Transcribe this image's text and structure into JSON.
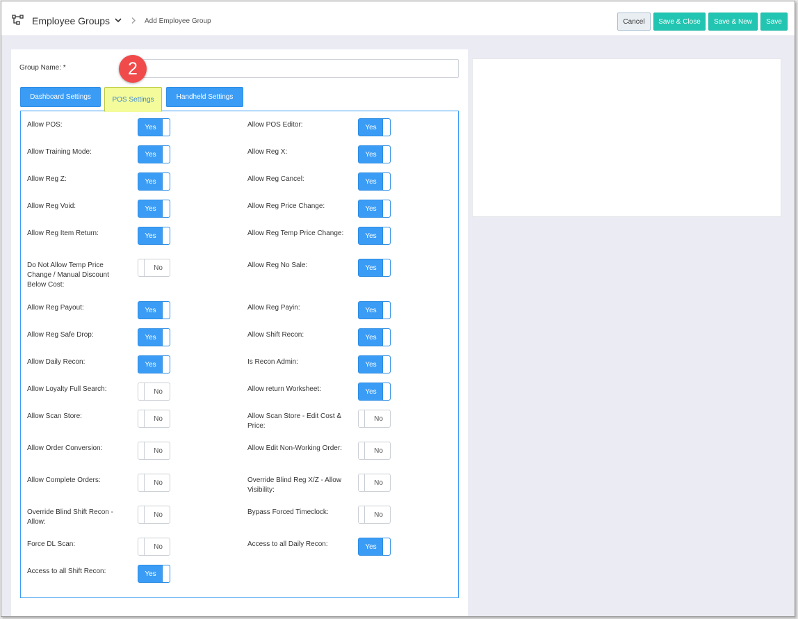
{
  "header": {
    "module_title": "Employee Groups",
    "breadcrumb": "Add Employee Group",
    "buttons": {
      "cancel": "Cancel",
      "save_close": "Save & Close",
      "save_new": "Save & New",
      "save": "Save"
    }
  },
  "form": {
    "group_name_label": "Group Name: *",
    "group_name_value": ""
  },
  "callout_number": "2",
  "tabs": {
    "dashboard": "Dashboard Settings",
    "pos": "POS Settings",
    "handheld": "Handheld Settings"
  },
  "pos_settings": {
    "left": [
      {
        "label": "Allow POS:",
        "value": "Yes"
      },
      {
        "label": "Allow Training Mode:",
        "value": "Yes"
      },
      {
        "label": "Allow Reg Z:",
        "value": "Yes"
      },
      {
        "label": "Allow Reg Void:",
        "value": "Yes"
      },
      {
        "label": "Allow Reg Item Return:",
        "value": "Yes"
      },
      {
        "label": "Do Not Allow Temp Price Change / Manual Discount Below Cost:",
        "value": "No"
      },
      {
        "label": "Allow Reg Payout:",
        "value": "Yes"
      },
      {
        "label": "Allow Reg Safe Drop:",
        "value": "Yes"
      },
      {
        "label": "Allow Daily Recon:",
        "value": "Yes"
      },
      {
        "label": "Allow Loyalty Full Search:",
        "value": "No"
      },
      {
        "label": "Allow Scan Store:",
        "value": "No"
      },
      {
        "label": "Allow Order Conversion:",
        "value": "No"
      },
      {
        "label": "Allow Complete Orders:",
        "value": "No"
      },
      {
        "label": "Override Blind Shift Recon - Allow:",
        "value": "No"
      },
      {
        "label": "Force DL Scan:",
        "value": "No"
      },
      {
        "label": "Access to all Shift Recon:",
        "value": "Yes"
      }
    ],
    "right": [
      {
        "label": "Allow POS Editor:",
        "value": "Yes"
      },
      {
        "label": "Allow Reg X:",
        "value": "Yes"
      },
      {
        "label": "Allow Reg Cancel:",
        "value": "Yes"
      },
      {
        "label": "Allow Reg Price Change:",
        "value": "Yes"
      },
      {
        "label": "Allow Reg Temp Price Change:",
        "value": "Yes"
      },
      {
        "label": "Allow Reg No Sale:",
        "value": "Yes"
      },
      {
        "label": "Allow Reg Payin:",
        "value": "Yes"
      },
      {
        "label": "Allow Shift Recon:",
        "value": "Yes"
      },
      {
        "label": "Is Recon Admin:",
        "value": "Yes"
      },
      {
        "label": "Allow return Worksheet:",
        "value": "Yes"
      },
      {
        "label": "Allow Scan Store - Edit Cost & Price:",
        "value": "No"
      },
      {
        "label": "Allow Edit Non-Working Order:",
        "value": "No"
      },
      {
        "label": "Override Blind Reg X/Z - Allow Visibility:",
        "value": "No"
      },
      {
        "label": "Bypass Forced Timeclock:",
        "value": "No"
      },
      {
        "label": "Access to all Daily Recon:",
        "value": "Yes"
      }
    ]
  },
  "colors": {
    "accent": "#3a9cf5",
    "teal": "#21c5b1",
    "highlight": "#f4fb9a",
    "badge": "#f04a4a"
  }
}
